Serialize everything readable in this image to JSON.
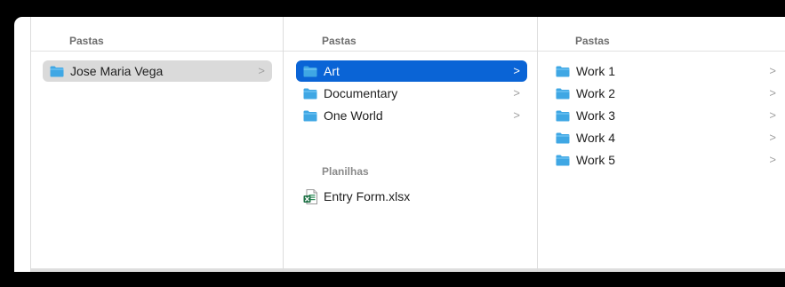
{
  "colors": {
    "accent": "#0a64d6",
    "folder": "#3fa7e4",
    "folder_top": "#67bff0",
    "excel_green": "#1e7145"
  },
  "columns": [
    {
      "header": "Pastas",
      "items": [
        {
          "label": "Jose Maria Vega",
          "icon": "folder-icon",
          "chevron": ">",
          "state": "selected-inactive"
        }
      ]
    },
    {
      "header": "Pastas",
      "items": [
        {
          "label": "Art",
          "icon": "folder-icon",
          "chevron": ">",
          "state": "selected-active"
        },
        {
          "label": "Documentary",
          "icon": "folder-icon",
          "chevron": ">",
          "state": "normal"
        },
        {
          "label": "One World",
          "icon": "folder-icon",
          "chevron": ">",
          "state": "normal"
        }
      ],
      "section": {
        "title": "Planilhas",
        "items": [
          {
            "label": "Entry Form.xlsx",
            "icon": "excel-file-icon"
          }
        ]
      }
    },
    {
      "header": "Pastas",
      "items": [
        {
          "label": "Work 1",
          "icon": "folder-icon",
          "chevron": ">"
        },
        {
          "label": "Work 2",
          "icon": "folder-icon",
          "chevron": ">"
        },
        {
          "label": "Work 3",
          "icon": "folder-icon",
          "chevron": ">"
        },
        {
          "label": "Work 4",
          "icon": "folder-icon",
          "chevron": ">"
        },
        {
          "label": "Work 5",
          "icon": "folder-icon",
          "chevron": ">"
        }
      ]
    }
  ]
}
